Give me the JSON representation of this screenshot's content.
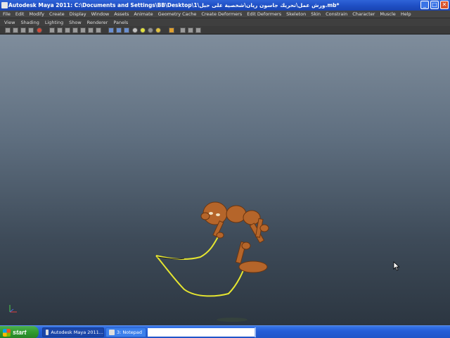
{
  "window": {
    "title": "Autodesk Maya 2011: C:\\Documents and Settings\\BB\\Desktop\\ورش عمل\\تحريك جاسون ريان\\شخصية على حبل\\1.mb*",
    "minimize_glyph": "_",
    "maximize_glyph": "□",
    "close_glyph": "✕"
  },
  "menubar": {
    "items": [
      "File",
      "Edit",
      "Modify",
      "Create",
      "Display",
      "Window",
      "Assets",
      "Animate",
      "Geometry Cache",
      "Create Deformers",
      "Edit Deformers",
      "Skeleton",
      "Skin",
      "Constrain",
      "Character",
      "Muscle",
      "Help"
    ]
  },
  "panel_menu": {
    "items": [
      "View",
      "Shading",
      "Lighting",
      "Show",
      "Renderer",
      "Panels"
    ]
  },
  "toolbar": {
    "icons": [
      "camera-icon",
      "grid-icon",
      "bookmark-icon",
      "image-plane-icon",
      "2d-pan-icon",
      "wireframe-icon",
      "smooth-shade-icon",
      "textured-icon",
      "lights-icon",
      "shadows-icon",
      "isolate-icon",
      "xray-icon",
      "joints-icon"
    ]
  },
  "viewport": {
    "background_top": "#7f8d9c",
    "background_bottom": "#2c3641",
    "character_color": "#b5652a",
    "rope_color": "#e6e630",
    "axis_labels": {
      "y": "Y",
      "x": "X"
    }
  },
  "taskbar": {
    "start_label": "start",
    "tasks": [
      {
        "label": "Autodesk Maya 2011...",
        "state": "active"
      },
      {
        "label": "3: Notepad",
        "state": "inactive"
      }
    ]
  }
}
